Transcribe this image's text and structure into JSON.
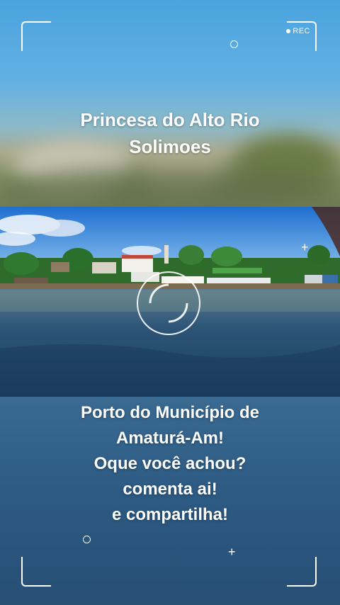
{
  "overlay": {
    "rec_label": "REC",
    "title_lines": [
      "Princesa do Alto Rio",
      "Solimoes"
    ],
    "caption_lines": [
      "Porto do Município de",
      "Amaturá-Am!",
      "Oque você achou?",
      "comenta ai!",
      "e compartilha!"
    ]
  },
  "photo": {
    "description_icon": "river-port-photo"
  },
  "colors": {
    "sky": "#4aa3de",
    "water": "#2a557d",
    "text": "#ffffff"
  }
}
